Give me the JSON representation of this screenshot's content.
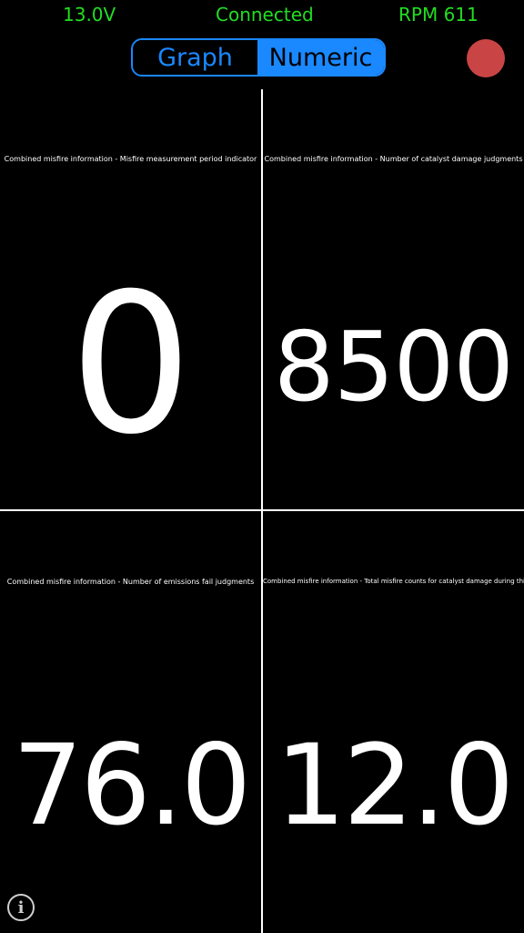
{
  "status_bar": {
    "voltage": "13.0V",
    "connection": "Connected",
    "rpm": "RPM 611"
  },
  "view_toggle": {
    "graph_label": "Graph",
    "numeric_label": "Numeric",
    "selected": "Numeric"
  },
  "record_button": {
    "icon": "record-dot-icon",
    "color": "#c94444"
  },
  "gauges": [
    {
      "title": "Combined misfire information  -  Misfire measurement period indicator",
      "value": "0"
    },
    {
      "title": "Combined misfire information  -  Number of catalyst damage judgments",
      "value": "8500"
    },
    {
      "title": "Combined misfire information  -  Number of emissions fail judgments",
      "value": "76.0"
    },
    {
      "title": "Combined misfire information  -  Total misfire counts for catalyst damage during this trip",
      "value": "12.0"
    }
  ],
  "info_button": {
    "icon": "info-icon",
    "glyph": "i"
  },
  "colors": {
    "status_text": "#22dd22",
    "accent": "#1a88ff",
    "background": "#000000",
    "record": "#c94444"
  }
}
